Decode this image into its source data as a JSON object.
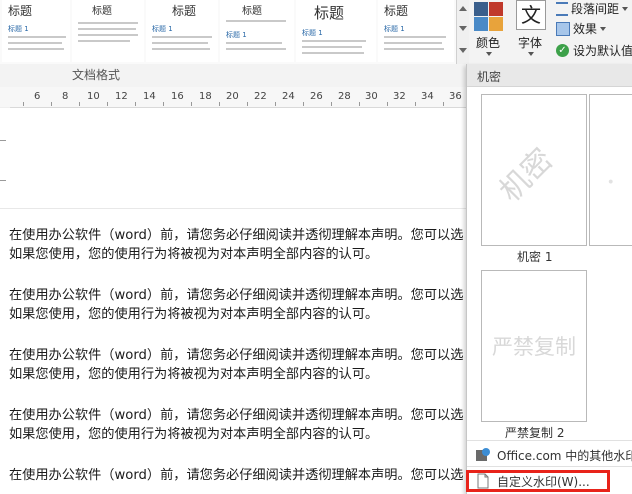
{
  "ribbon": {
    "style_cards": [
      {
        "title": "标题",
        "subtitle": "标题 1"
      },
      {
        "title": "标题",
        "subtitle": ""
      },
      {
        "title": "标题",
        "subtitle": "标题 1"
      },
      {
        "title": "标题",
        "subtitle": "标题 1"
      },
      {
        "title": "标题",
        "subtitle": "标题 1"
      },
      {
        "title": "标题",
        "subtitle": "标题 1"
      }
    ],
    "colors_label": "颜色",
    "fonts_label": "字体",
    "fonts_glyph": "文",
    "paragraph_spacing_label": "段落间距",
    "effects_label": "效果",
    "set_default_label": "设为默认值",
    "group_label": "文档格式"
  },
  "ruler": {
    "numbers": [
      "6",
      "8",
      "10",
      "12",
      "14",
      "16",
      "18",
      "20",
      "22",
      "24",
      "26",
      "28",
      "30",
      "32",
      "34",
      "36"
    ]
  },
  "document": {
    "paragraphs": [
      {
        "line1": "在使用办公软件（word）前，请您务必仔细阅读并透彻理解本声明。您可以选",
        "line2": "如果您使用，您的使用行为将被视为对本声明全部内容的认可。"
      },
      {
        "line1": "在使用办公软件（word）前，请您务必仔细阅读并透彻理解本声明。您可以选",
        "line2": "如果您使用，您的使用行为将被视为对本声明全部内容的认可。"
      },
      {
        "line1": "在使用办公软件（word）前，请您务必仔细阅读并透彻理解本声明。您可以选",
        "line2": "如果您使用，您的使用行为将被视为对本声明全部内容的认可。"
      },
      {
        "line1": "在使用办公软件（word）前，请您务必仔细阅读并透彻理解本声明。您可以选",
        "line2": "如果您使用，您的使用行为将被视为对本声明全部内容的认可。"
      },
      {
        "line1": "在使用办公软件（word）前，请您务必仔细阅读并透彻理解本声明。您可以选",
        "line2": ""
      }
    ]
  },
  "watermark_menu": {
    "header": "机密",
    "thumbnails": [
      {
        "caption": "机密 1",
        "watermark_text": "机密"
      },
      {
        "caption": "严禁复制 2",
        "watermark_text": "严禁复制"
      }
    ],
    "office_more": "Office.com 中的其他水印",
    "custom": "自定义水印(W)..."
  },
  "colors": {
    "accent_red": "#e8231a",
    "link_blue": "#2b6aa8"
  }
}
